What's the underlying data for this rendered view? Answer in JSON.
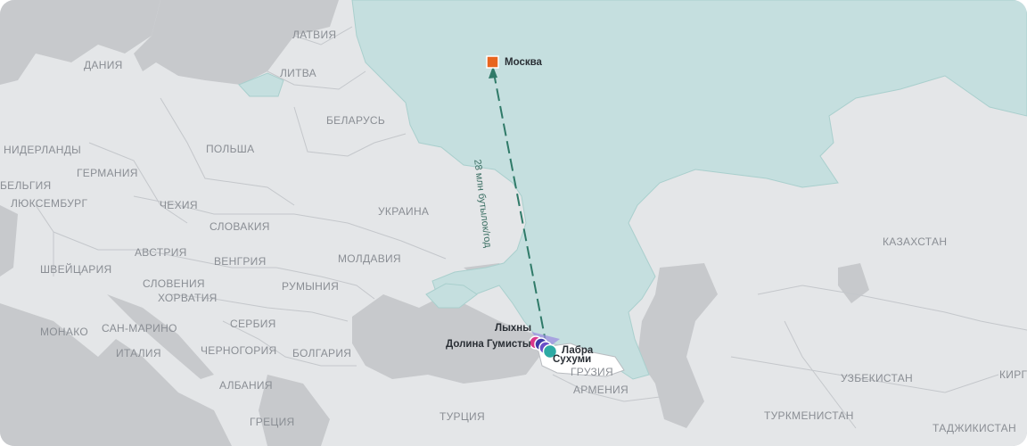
{
  "map": {
    "countries": [
      {
        "name": "ЛАТВИЯ"
      },
      {
        "name": "ДАНИЯ"
      },
      {
        "name": "ЛИТВА"
      },
      {
        "name": "БЕЛАРУСЬ"
      },
      {
        "name": "НИДЕРЛАНДЫ"
      },
      {
        "name": "ПОЛЬША"
      },
      {
        "name": "ГЕРМАНИЯ"
      },
      {
        "name": "БЕЛЬГИЯ"
      },
      {
        "name": "ЛЮКСЕМБУРГ"
      },
      {
        "name": "ЧЕХИЯ"
      },
      {
        "name": "УКРАИНА"
      },
      {
        "name": "СЛОВАКИЯ"
      },
      {
        "name": "АВСТРИЯ"
      },
      {
        "name": "ВЕНГРИЯ"
      },
      {
        "name": "МОЛДАВИЯ"
      },
      {
        "name": "ШВЕЙЦАРИЯ"
      },
      {
        "name": "СЛОВЕНИЯ"
      },
      {
        "name": "ХОРВАТИЯ"
      },
      {
        "name": "РУМЫНИЯ"
      },
      {
        "name": "СЕРБИЯ"
      },
      {
        "name": "САН-МАРИНО"
      },
      {
        "name": "МОНАКО"
      },
      {
        "name": "ИТАЛИЯ"
      },
      {
        "name": "ЧЕРНОГОРИЯ"
      },
      {
        "name": "БОЛГАРИЯ"
      },
      {
        "name": "АЛБАНИЯ"
      },
      {
        "name": "ГРУЗИЯ"
      },
      {
        "name": "АРМЕНИЯ"
      },
      {
        "name": "ТУРЦИЯ"
      },
      {
        "name": "ГРЕЦИЯ"
      },
      {
        "name": "КАЗАХСТАН"
      },
      {
        "name": "УЗБЕКИСТАН"
      },
      {
        "name": "КИРГ"
      },
      {
        "name": "ТУРКМЕНИСТАН"
      },
      {
        "name": "ТАДЖИКИСТАН"
      }
    ],
    "places": {
      "moscow": "Москва",
      "lykhny": "Лыхны",
      "gumista": "Долина Гумисты",
      "labra": "Лабра",
      "sukhumi": "Сухуми"
    },
    "route_label": "28 млн бутылок/год",
    "colors": {
      "russia_fill": "#c5dfdf",
      "land": "#e4e6e8",
      "sea": "#c7c9cc",
      "route": "#2f7a68",
      "moscow_marker": "#e8651f",
      "marker_pink": "#d9378a",
      "marker_indigo": "#3f3aa8",
      "marker_purple": "#6b4fc8",
      "marker_teal": "#2eaaa4"
    }
  }
}
